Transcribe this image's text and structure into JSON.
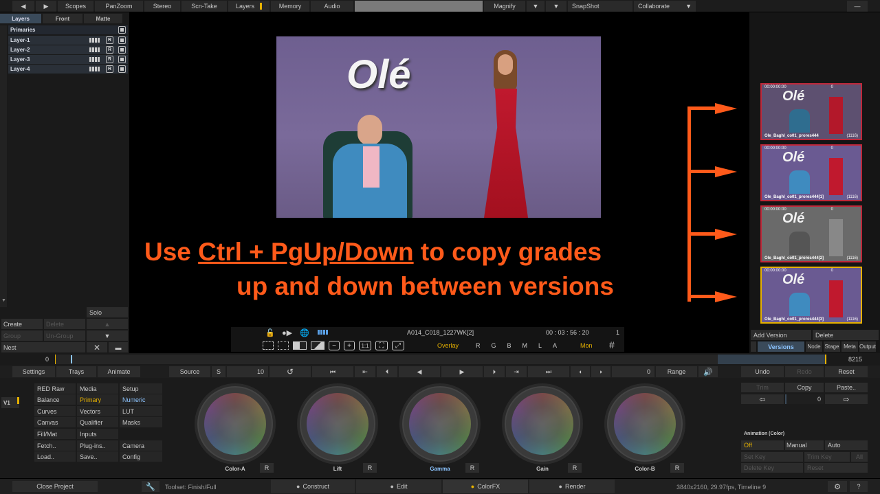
{
  "topbar": {
    "items": [
      "Scopes",
      "PanZoom",
      "Stereo",
      "Scn-Take",
      "Layers",
      "Memory",
      "Audio",
      "Magnify",
      "SnapShot",
      "Collaborate"
    ]
  },
  "left": {
    "tabs": [
      "Layers",
      "Front",
      "Matte"
    ],
    "primaries": "Primaries",
    "layers": [
      "Layer-1",
      "Layer-2",
      "Layer-3",
      "Layer-4"
    ],
    "r": "R",
    "solo": "Solo",
    "create": "Create",
    "delete": "Delete",
    "group": "Group",
    "ungroup": "Un-Group",
    "nest": "Nest"
  },
  "viewer": {
    "clip": "A014_C018_1227WK[2]",
    "timecode": "00 : 03 : 56 : 20",
    "count": "1",
    "overlay": "Overlay",
    "channels": [
      "R",
      "G",
      "B",
      "M",
      "L",
      "A"
    ],
    "mon": "Mon",
    "one_to_one": "1:1",
    "brand": "Olé",
    "hint_line1_a": "Use ",
    "hint_line1_b": "Ctrl + PgUp/Down",
    "hint_line1_c": " to copy grades",
    "hint_line2": "up and down between versions"
  },
  "versions": {
    "thumbs": [
      {
        "tc": "00:00:00:00",
        "zero": "0",
        "name": "Ole_Baghl_co01_prores444",
        "count": "(1116)"
      },
      {
        "tc": "00:00:00:00",
        "zero": "0",
        "name": "Ole_Baghl_co01_prores444[1]",
        "count": "(1116)"
      },
      {
        "tc": "00:00:00:00",
        "zero": "0",
        "name": "Ole_Baghl_co01_prores444[2]",
        "count": "(1116)"
      },
      {
        "tc": "00:00:00:00",
        "zero": "0",
        "name": "Ole_Baghl_co01_prores444[3]",
        "count": "(1116)"
      }
    ],
    "add_version": "Add Version",
    "delete": "Delete",
    "tabs": [
      "Versions",
      "Node",
      "Stage",
      "Meta",
      "Output"
    ]
  },
  "timeline": {
    "start": "0",
    "end": "8215"
  },
  "transport": {
    "settings": "Settings",
    "trays": "Trays",
    "animate": "Animate",
    "source": "Source",
    "s": "S",
    "step": "10",
    "frame": "0",
    "range": "Range",
    "undo": "Undo",
    "redo": "Redo",
    "reset": "Reset"
  },
  "menu": {
    "track": "V1",
    "col1": [
      "RED Raw",
      "Balance",
      "Curves",
      "Canvas",
      "Fill/Mat",
      "Fetch..",
      "Load.."
    ],
    "col2": [
      "Media",
      "Primary",
      "Vectors",
      "Qualifier",
      "Inputs",
      "Plug-ins..",
      "Save.."
    ],
    "col3": [
      "Setup",
      "Numeric",
      "LUT",
      "Masks",
      "",
      "Camera",
      "Config"
    ]
  },
  "wheels": [
    "Color-A",
    "Lift",
    "Gamma",
    "Gain",
    "Color-B"
  ],
  "wheel_r": "R",
  "copy_panel": {
    "trim": "Trim",
    "copy": "Copy",
    "paste": "Paste..",
    "value": "0",
    "anim_title": "Animation (Color)",
    "off": "Off",
    "manual": "Manual",
    "auto": "Auto",
    "set_key": "Set Key",
    "trim_key": "Trim Key",
    "all": "All",
    "delete_key": "Delete Key",
    "reset": "Reset"
  },
  "status": {
    "close_project": "Close Project",
    "toolset": "Toolset: Finish/Full",
    "modes": [
      "Construct",
      "Edit",
      "ColorFX",
      "Render"
    ],
    "info": "3840x2160, 29.97fps, Timeline 9",
    "help": "?"
  },
  "colors": {
    "accent": "#ff5a1a",
    "active_mode": "#e6b100",
    "selected_thumb": "#e6b100",
    "thumb_border": "#c0283a"
  }
}
